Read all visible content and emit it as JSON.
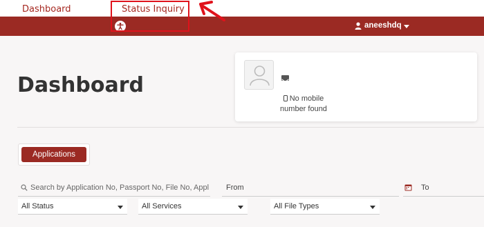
{
  "topnav": {
    "dashboard_label": "Dashboard",
    "status_label": "Status Inquiry"
  },
  "header": {
    "username": "aneeshdq",
    "accessibility_icon": "accessibility-icon",
    "user_icon": "user-icon"
  },
  "page": {
    "title": "Dashboard"
  },
  "profile_card": {
    "mobile_text_line1": "No mobile",
    "mobile_text_line2": "number found",
    "mail_icon": "envelope-icon",
    "phone_icon": "phone-icon"
  },
  "tabs": {
    "applications_label": "Applications"
  },
  "filters": {
    "search_placeholder": "Search by Application No, Passport No, File No, Applic",
    "from_label": "From",
    "to_label": "To",
    "status_value": "All Status",
    "services_value": "All Services",
    "file_types_value": "All File Types"
  },
  "colors": {
    "brand": "#9b2a23",
    "link": "#a5271f",
    "callout": "#e0121b"
  }
}
